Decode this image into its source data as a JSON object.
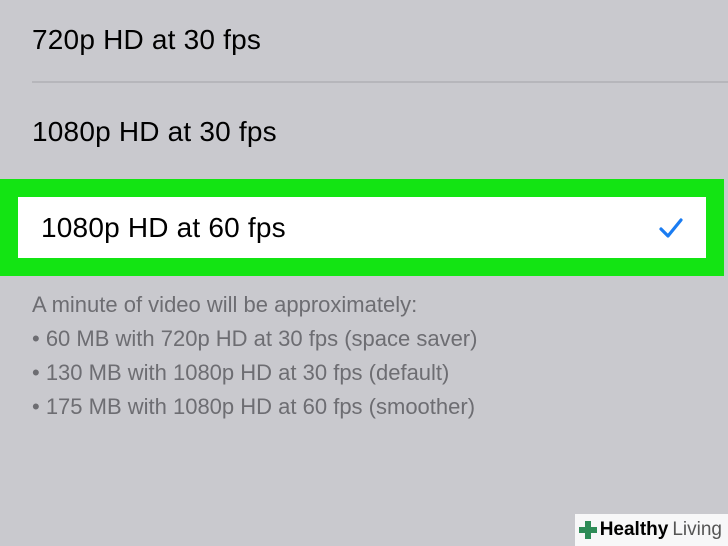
{
  "options": [
    {
      "label": "720p HD at 30 fps",
      "selected": false
    },
    {
      "label": "1080p HD at 30 fps",
      "selected": false
    },
    {
      "label": "1080p HD at 60 fps",
      "selected": true
    }
  ],
  "footer": {
    "intro": "A minute of video will be approximately:",
    "lines": [
      "• 60 MB with 720p HD at 30 fps (space saver)",
      "• 130 MB with 1080p HD at 30 fps (default)",
      "• 175 MB with 1080p HD at 60 fps (smoother)"
    ]
  },
  "watermark": {
    "brand_strong": "Healthy",
    "brand_light": "Living"
  },
  "icons": {
    "selected_check": "checkmark-icon",
    "watermark_logo": "cross-icon"
  },
  "colors": {
    "background": "#c9c9ce",
    "selected_row": "#ffffff",
    "highlight": "#13e413",
    "check": "#1a7cf2",
    "footer_text": "#6d6d72"
  }
}
